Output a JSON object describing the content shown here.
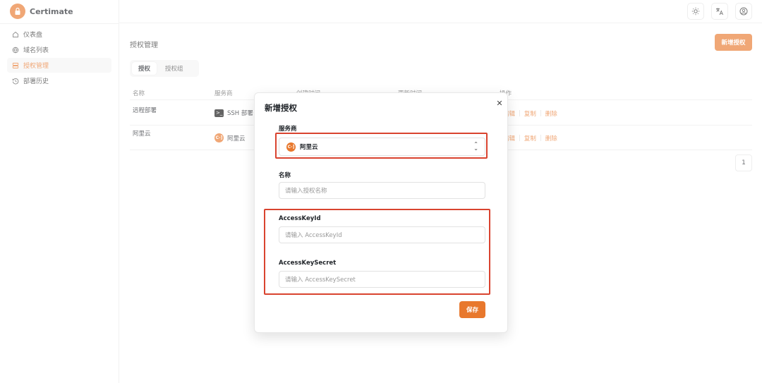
{
  "app": {
    "name": "Certimate"
  },
  "sidebar": {
    "items": [
      {
        "label": "仪表盘",
        "icon": "home-icon"
      },
      {
        "label": "域名列表",
        "icon": "globe-icon"
      },
      {
        "label": "授权管理",
        "icon": "server-icon",
        "active": true
      },
      {
        "label": "部署历史",
        "icon": "history-icon"
      }
    ]
  },
  "topbar": {
    "icons": [
      "sun-icon",
      "translate-icon",
      "user-circle-icon"
    ]
  },
  "page": {
    "title": "授权管理",
    "add_button": "新增授权",
    "tabs": [
      {
        "label": "授权",
        "active": true
      },
      {
        "label": "授权组"
      }
    ]
  },
  "table": {
    "columns": [
      "名称",
      "服务商",
      "创建时间",
      "更新时间",
      "操作"
    ],
    "rows": [
      {
        "name": "远程部署",
        "provider": "SSH 部署",
        "provider_icon": "terminal-icon",
        "actions": [
          "编辑",
          "复制",
          "删除"
        ]
      },
      {
        "name": "阿里云",
        "provider": "阿里云",
        "provider_icon": "aliyun-icon",
        "actions": [
          "编辑",
          "复制",
          "删除"
        ]
      }
    ]
  },
  "pagination": {
    "current": "1"
  },
  "modal": {
    "title": "新增授权",
    "provider_label": "服务商",
    "provider_value": "阿里云",
    "name_label": "名称",
    "name_placeholder": "请输入授权名称",
    "key_id_label": "AccessKeyId",
    "key_id_placeholder": "请输入 AccessKeyId",
    "key_secret_label": "AccessKeySecret",
    "key_secret_placeholder": "请输入 AccessKeySecret",
    "save_button": "保存"
  },
  "colors": {
    "accent": "#e8782d",
    "highlight": "#d9432f"
  }
}
